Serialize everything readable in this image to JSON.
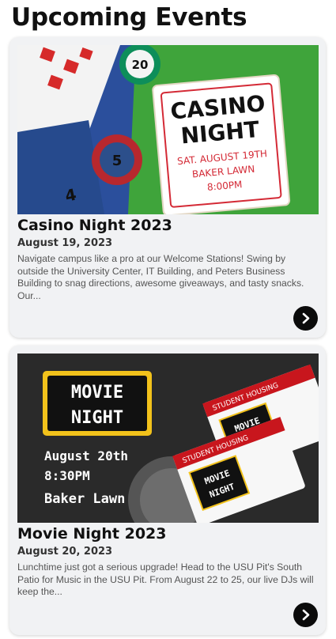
{
  "page": {
    "title": "Upcoming Events"
  },
  "events": [
    {
      "title": "Casino Night 2023",
      "date": "August 19, 2023",
      "description": "Navigate campus like a pro at our Welcome Stations! Swing by outside the University Center, IT Building, and Peters Business Building to snag directions, awesome giveaways, and tasty snacks. Our...",
      "image": {
        "headline_1": "CASINO",
        "headline_2": "NIGHT",
        "line_1": "SAT. AUGUST 19TH",
        "line_2": "BAKER LAWN",
        "line_3": "8:00PM",
        "chip_value_1": "20",
        "chip_value_2": "5"
      },
      "next_icon": "chevron-right-icon"
    },
    {
      "title": "Movie Night 2023",
      "date": "August 20, 2023",
      "description": "Lunchtime just got a serious upgrade! Head to the USU Pit's South Patio for Music in the USU Pit. From August 22 to 25, our live DJs will keep the...",
      "image": {
        "sign_1": "MOVIE",
        "sign_2": "NIGHT",
        "line_1": "August 20th",
        "line_2": "8:30PM",
        "line_3": "Baker Lawn",
        "ticket_header": "STUDENT HOUSING"
      },
      "next_icon": "chevron-right-icon"
    }
  ],
  "colors": {
    "button": "#0b0b0b",
    "card_bg": "#f1f2f4",
    "casino_red": "#d42a36",
    "ticket_red": "#c8161d",
    "marquee_yellow": "#f2c21b"
  }
}
